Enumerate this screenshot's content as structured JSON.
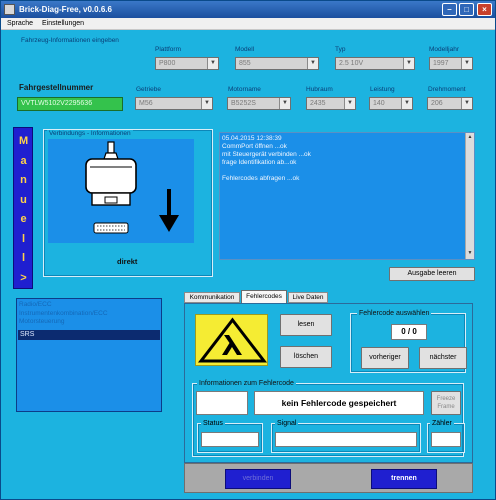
{
  "window": {
    "title": "Brick-Diag-Free, v0.0.6.6"
  },
  "menu": {
    "items": [
      "Sprache",
      "Einstellungen"
    ]
  },
  "vehicle": {
    "group_label": "Fahrzeug-Informationen eingeben",
    "vin_label": "Fahrgestellnummer",
    "vin_value": "VVTLW5102V2295636",
    "row1": [
      {
        "label": "Plattform",
        "value": "P800"
      },
      {
        "label": "Modell",
        "value": "855"
      },
      {
        "label": "Typ",
        "value": "2.5 10V"
      },
      {
        "label": "Modelljahr",
        "value": "1997"
      }
    ],
    "row2": [
      {
        "label": "Getriebe",
        "value": "M56"
      },
      {
        "label": "Motorname",
        "value": "B5252S"
      },
      {
        "label": "Hubraum",
        "value": "2435"
      },
      {
        "label": "Leistung",
        "value": "140"
      },
      {
        "label": "Drehmoment",
        "value": "206"
      }
    ]
  },
  "side_tab": {
    "letters": [
      "M",
      "a",
      "n",
      "u",
      "e",
      "l",
      "l",
      ">"
    ]
  },
  "connection": {
    "group_label": "Verbindungs - Informationen",
    "mode": "direkt"
  },
  "log": {
    "lines": [
      "05.04.2015 12:38:39",
      "CommPort öffnen ...ok",
      "mit Steuergerät verbinden ...ok",
      "frage Identifikation ab...ok",
      "",
      "Fehlercodes abfragen ...ok"
    ],
    "clear_button": "Ausgabe leeren"
  },
  "modules": {
    "items": [
      "Radio/ECC",
      "Instrumentenkombination/ECC",
      "Motorsteuerung",
      "SRS"
    ],
    "selected": "SRS"
  },
  "tabs": {
    "items": [
      "Kommunikation",
      "Fehlercodes",
      "Live Daten"
    ],
    "active": "Fehlercodes"
  },
  "faults": {
    "read_button": "lesen",
    "clear_button": "löschen",
    "select_group": "Fehlercode auswählen",
    "counter": "0 / 0",
    "prev_button": "vorheriger",
    "next_button": "nächster",
    "info_group": "Informationen zum Fehlercode",
    "message": "kein Fehlercode gespeichert",
    "freeze_button": "Freeze Frame",
    "status_label": "Status",
    "signal_label": "Signal",
    "counter_label": "Zähler"
  },
  "bottom": {
    "connect_button": "verbinden",
    "disconnect_button": "trennen"
  },
  "colors": {
    "background": "#1cb3e0",
    "title": "#1b4f9e",
    "accent": "#1f1fd0"
  }
}
